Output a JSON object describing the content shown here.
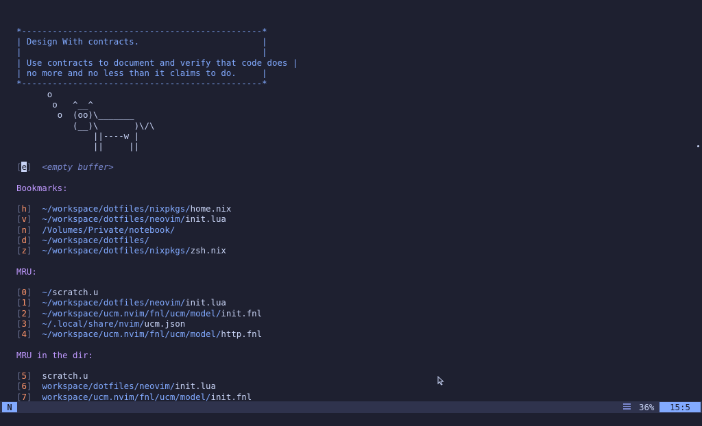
{
  "cowsay": {
    "box_top": "*-----------------------------------------------*",
    "box_line1": "| Design With contracts.                        |",
    "box_line2": "|                                               |",
    "box_line3": "| Use contracts to document and verify that code does |",
    "box_line4": "| no more and no less than it claims to do.     |",
    "box_bottom": "*-----------------------------------------------*",
    "cow": [
      "      o",
      "       o   ^__^",
      "        o  (oo)\\_______",
      "           (__)\\       )\\/\\",
      "               ||----w |",
      "               ||     ||"
    ]
  },
  "empty_buffer": {
    "key": "e",
    "label": "<empty buffer>"
  },
  "sections": {
    "bookmarks_title": "Bookmarks:",
    "mru_title": "MRU:",
    "mru_dir_title": "MRU in the dir:"
  },
  "bookmarks": [
    {
      "key": "h",
      "dir": "~/workspace/dotfiles/nixpkgs/",
      "file": "home.nix"
    },
    {
      "key": "v",
      "dir": "~/workspace/dotfiles/neovim/",
      "file": "init.lua"
    },
    {
      "key": "n",
      "dir": "/Volumes/Private/notebook/",
      "file": ""
    },
    {
      "key": "d",
      "dir": "~/workspace/dotfiles/",
      "file": ""
    },
    {
      "key": "z",
      "dir": "~/workspace/dotfiles/nixpkgs/",
      "file": "zsh.nix"
    }
  ],
  "mru": [
    {
      "key": "0",
      "dir": "~/",
      "file": "scratch.u"
    },
    {
      "key": "1",
      "dir": "~/workspace/dotfiles/neovim/",
      "file": "init.lua"
    },
    {
      "key": "2",
      "dir": "~/workspace/ucm.nvim/fnl/ucm/model/",
      "file": "init.fnl"
    },
    {
      "key": "3",
      "dir": "~/.local/share/nvim/",
      "file": "ucm.json"
    },
    {
      "key": "4",
      "dir": "~/workspace/ucm.nvim/fnl/ucm/model/",
      "file": "http.fnl"
    }
  ],
  "mru_dir": [
    {
      "key": "5",
      "dir": "",
      "file": "scratch.u"
    },
    {
      "key": "6",
      "dir": "workspace/dotfiles/neovim/",
      "file": "init.lua"
    },
    {
      "key": "7",
      "dir": "workspace/ucm.nvim/fnl/ucm/model/",
      "file": "init.fnl"
    }
  ],
  "statusline": {
    "mode": "N",
    "percent": "36%",
    "position": "15:5"
  },
  "colors": {
    "background": "#1e2030",
    "accent": "#82aaff",
    "section": "#c099ff",
    "key": "#ff966c"
  }
}
